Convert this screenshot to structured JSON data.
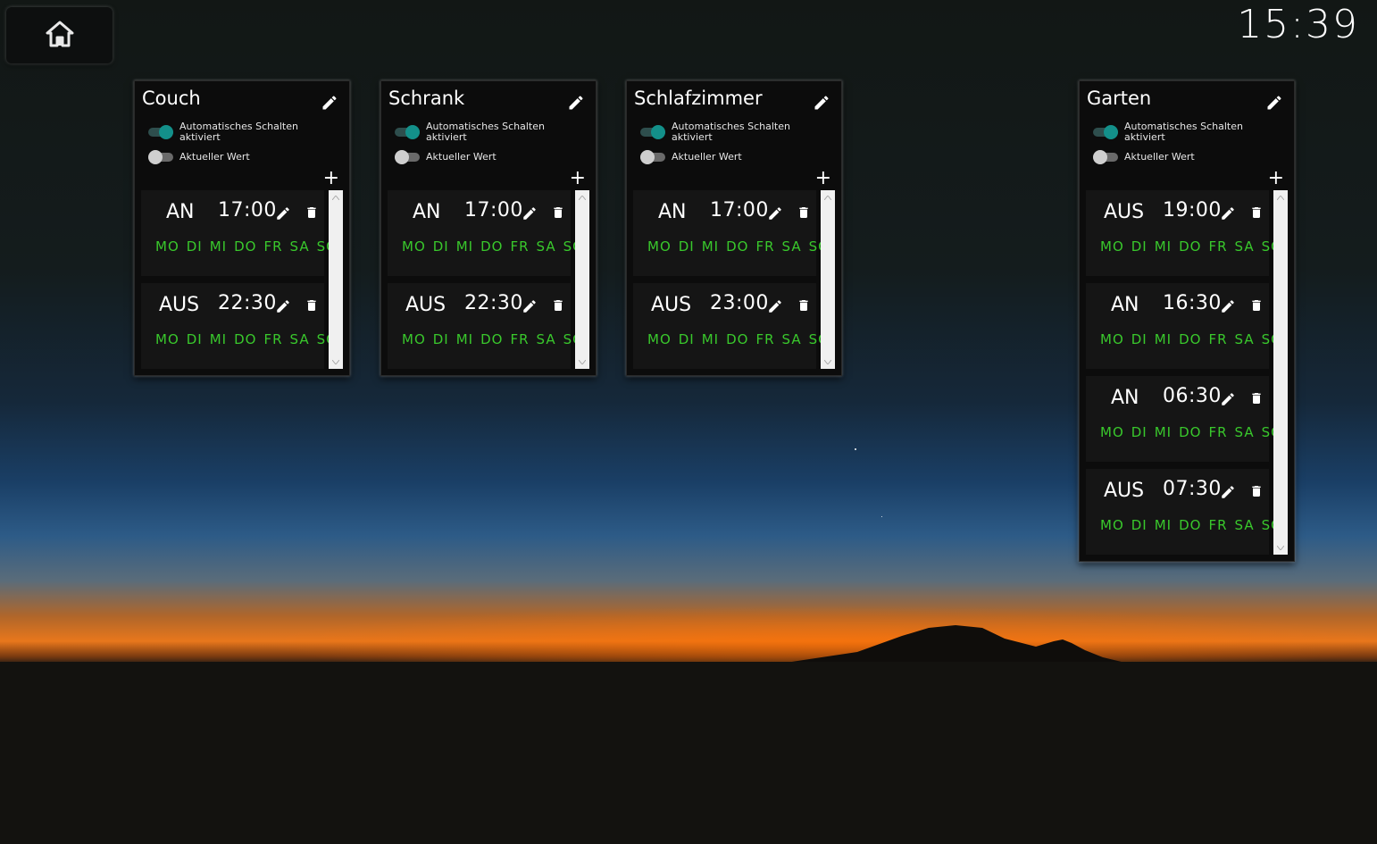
{
  "clock": "15:39",
  "labels": {
    "auto_switch": "Automatisches Schalten aktiviert",
    "current_value": "Aktueller Wert",
    "add": "+"
  },
  "rooms": [
    {
      "name": "Couch",
      "auto": true,
      "current": false,
      "entries": [
        {
          "state": "AN",
          "time": "17:00",
          "days": [
            "MO",
            "DI",
            "MI",
            "DO",
            "FR",
            "SA",
            "SO"
          ]
        },
        {
          "state": "AUS",
          "time": "22:30",
          "days": [
            "MO",
            "DI",
            "MI",
            "DO",
            "FR",
            "SA",
            "SO"
          ]
        }
      ]
    },
    {
      "name": "Schrank",
      "auto": true,
      "current": false,
      "entries": [
        {
          "state": "AN",
          "time": "17:00",
          "days": [
            "MO",
            "DI",
            "MI",
            "DO",
            "FR",
            "SA",
            "SO"
          ]
        },
        {
          "state": "AUS",
          "time": "22:30",
          "days": [
            "MO",
            "DI",
            "MI",
            "DO",
            "FR",
            "SA",
            "SO"
          ]
        }
      ]
    },
    {
      "name": "Schlafzimmer",
      "auto": true,
      "current": false,
      "entries": [
        {
          "state": "AN",
          "time": "17:00",
          "days": [
            "MO",
            "DI",
            "MI",
            "DO",
            "FR",
            "SA",
            "SO"
          ]
        },
        {
          "state": "AUS",
          "time": "23:00",
          "days": [
            "MO",
            "DI",
            "MI",
            "DO",
            "FR",
            "SA",
            "SO"
          ]
        }
      ]
    },
    {
      "name": "Garten",
      "auto": true,
      "current": false,
      "entries": [
        {
          "state": "AUS",
          "time": "19:00",
          "days": [
            "MO",
            "DI",
            "MI",
            "DO",
            "FR",
            "SA",
            "SO"
          ]
        },
        {
          "state": "AN",
          "time": "16:30",
          "days": [
            "MO",
            "DI",
            "MI",
            "DO",
            "FR",
            "SA",
            "SO"
          ]
        },
        {
          "state": "AN",
          "time": "06:30",
          "days": [
            "MO",
            "DI",
            "MI",
            "DO",
            "FR",
            "SA",
            "SO"
          ]
        },
        {
          "state": "AUS",
          "time": "07:30",
          "days": [
            "MO",
            "DI",
            "MI",
            "DO",
            "FR",
            "SA",
            "SO"
          ]
        }
      ]
    }
  ],
  "colors": {
    "day_text": "#39c82c",
    "toggle_on": "#13908a"
  },
  "icons": {
    "home": "home-icon",
    "edit": "pencil-icon",
    "delete": "trash-icon",
    "add": "plus-icon"
  }
}
